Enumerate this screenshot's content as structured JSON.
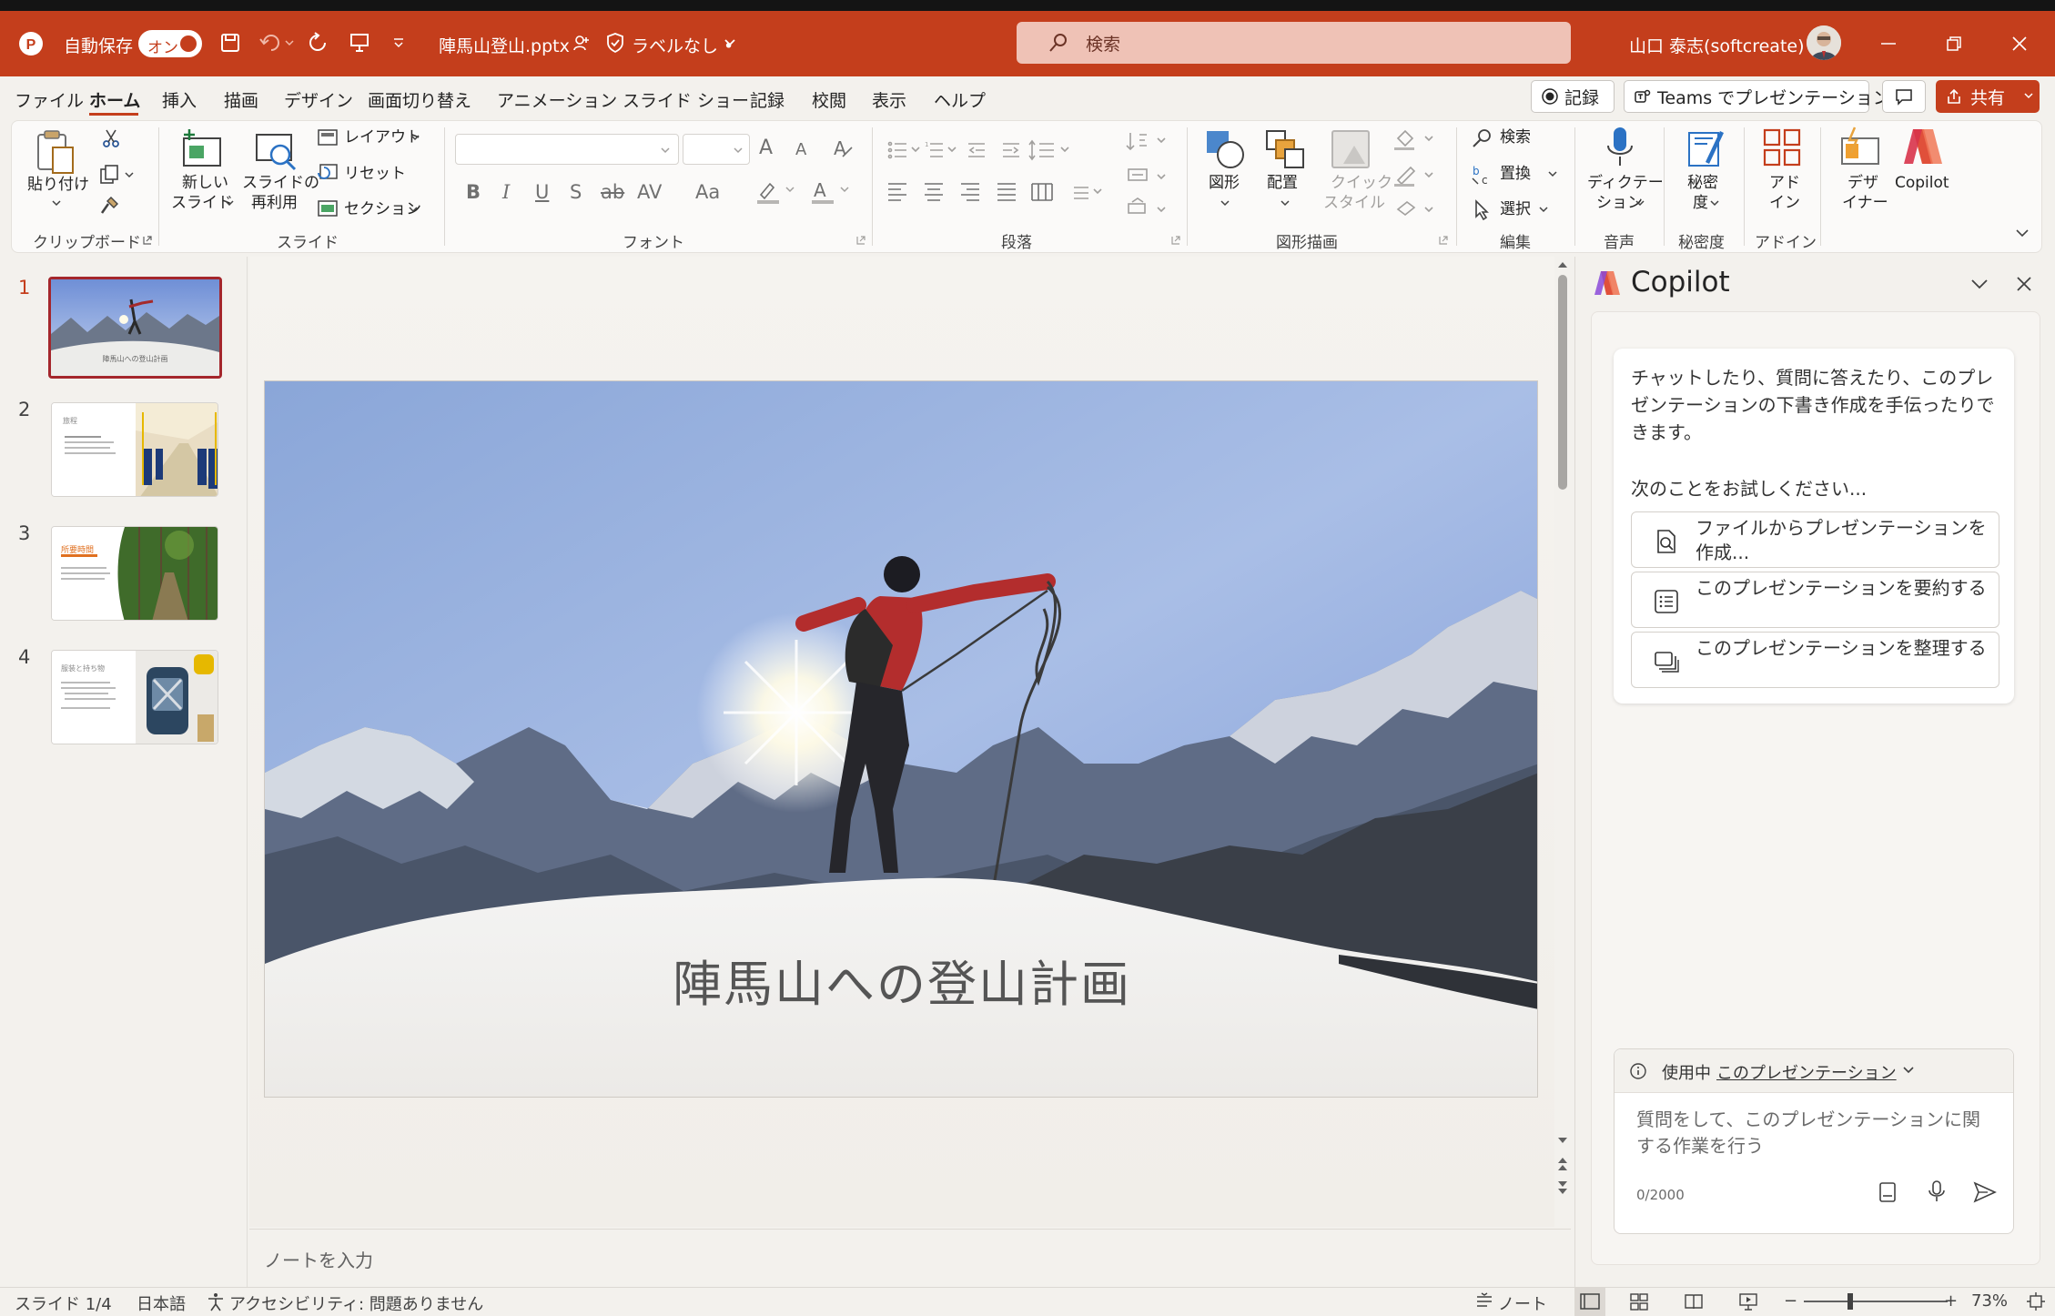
{
  "colors": {
    "accent": "#c43e1c",
    "slide_selected_border": "#a4262c"
  },
  "titlebar": {
    "autosave_label": "自動保存",
    "autosave_toggle": "オン",
    "filename": "陣馬山登山.pptx",
    "sensitivity": "ラベルなし •",
    "search_placeholder": "検索",
    "user_name": "山口 泰志(softcreate)"
  },
  "menu": {
    "tabs": [
      "ファイル",
      "ホーム",
      "挿入",
      "描画",
      "デザイン",
      "画面切り替え",
      "アニメーション",
      "スライド ショー",
      "記録",
      "校閲",
      "表示",
      "ヘルプ"
    ],
    "active_tab": "ホーム",
    "record_button": "記録",
    "teams_button": "Teams でプレゼンテーション",
    "share_button": "共有"
  },
  "ribbon": {
    "clipboard": {
      "paste": "貼り付け",
      "group": "クリップボード"
    },
    "slides": {
      "new_slide_1": "新しい",
      "new_slide_2": "スライド",
      "reuse_1": "スライドの",
      "reuse_2": "再利用",
      "layout": "レイアウト",
      "reset": "リセット",
      "section": "セクション",
      "group": "スライド"
    },
    "font": {
      "group": "フォント",
      "bold": "B",
      "italic": "I",
      "underline": "U",
      "shadow": "S",
      "strike": "ab",
      "spacing": "AV",
      "case": "Aa",
      "grow": "A",
      "shrink": "A"
    },
    "paragraph": {
      "group": "段落"
    },
    "drawing": {
      "shapes": "図形",
      "arrange": "配置",
      "quick_style_1": "クイック",
      "quick_style_2": "スタイル",
      "group": "図形描画"
    },
    "editing": {
      "find": "検索",
      "replace": "置換",
      "select": "選択",
      "group": "編集"
    },
    "voice": {
      "dictate_1": "ディクテー",
      "dictate_2": "ション",
      "group": "音声"
    },
    "sensitivity": {
      "label_1": "秘密",
      "label_2": "度",
      "group": "秘密度"
    },
    "addins": {
      "label_1": "アド",
      "label_2": "イン",
      "group": "アドイン"
    },
    "designer": {
      "label_1": "デザ",
      "label_2": "イナー"
    },
    "copilot": {
      "label": "Copilot"
    }
  },
  "thumbnails": [
    {
      "number": "1",
      "caption": "陣馬山への登山計画"
    },
    {
      "number": "2",
      "caption": "旅程"
    },
    {
      "number": "3",
      "caption": "所要時間"
    },
    {
      "number": "4",
      "caption": "服装と持ち物"
    }
  ],
  "slide": {
    "title": "陣馬山への登山計画"
  },
  "notes": {
    "placeholder": "ノートを入力"
  },
  "copilot": {
    "title": "Copilot",
    "intro": "チャットしたり、質問に答えたり、このプレゼンテーションの下書き作成を手伝ったりできます。",
    "try_label": "次のことをお試しください...",
    "suggestions": [
      "ファイルからプレゼンテーションを作成...",
      "このプレゼンテーションを要約する",
      "このプレゼンテーションを整理する"
    ],
    "context_label": "使用中",
    "context_link": "このプレゼンテーション",
    "input_placeholder": "質問をして、このプレゼンテーションに関する作業を行う",
    "char_count": "0/2000"
  },
  "status": {
    "slide_indicator": "スライド 1/4",
    "language": "日本語",
    "accessibility": "アクセシビリティ: 問題ありません",
    "notes_button": "ノート",
    "zoom": "73%"
  }
}
